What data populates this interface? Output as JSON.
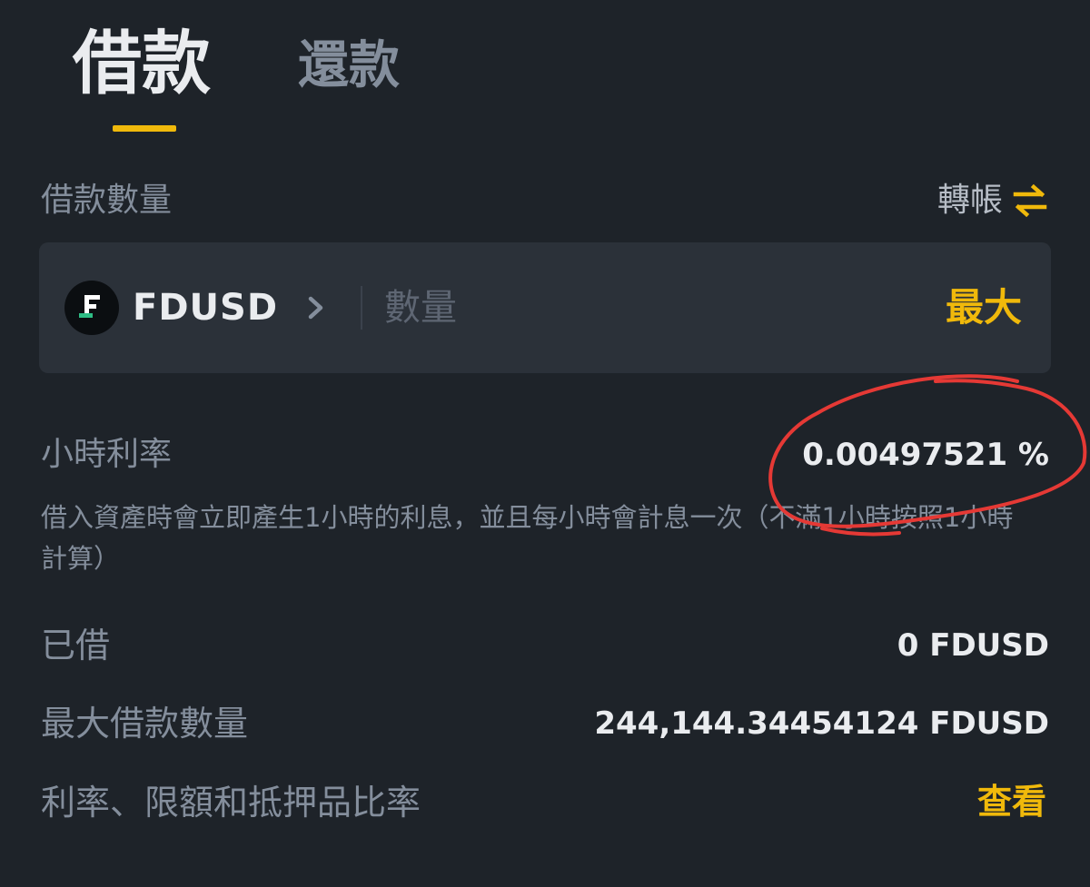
{
  "tabs": {
    "borrow": "借款",
    "repay": "還款"
  },
  "borrow_amount": {
    "label": "借款數量",
    "transfer_label": "轉帳"
  },
  "input": {
    "coin": "FDUSD",
    "placeholder": "數量",
    "max_label": "最大"
  },
  "hourly_rate": {
    "label": "小時利率",
    "value": "0.00497521 %",
    "note": "借入資產時會立即產生1小時的利息，並且每小時會計息一次（不滿1小時按照1小時計算）"
  },
  "borrowed": {
    "label": "已借",
    "value": "0 FDUSD"
  },
  "max_borrow": {
    "label": "最大借款數量",
    "value": "244,144.34454124 FDUSD"
  },
  "rates_link": {
    "label": "利率、限額和抵押品比率",
    "action": "查看"
  },
  "colors": {
    "background": "#1e2329",
    "input_bg": "#2b3139",
    "accent": "#f0b90b",
    "coin_logo_green": "#2ebd85",
    "annotation_red": "#e53935"
  },
  "icons": {
    "transfer": "swap-arrows-icon",
    "coin": "fdusd-logo-icon",
    "chevron": "chevron-right-icon"
  }
}
